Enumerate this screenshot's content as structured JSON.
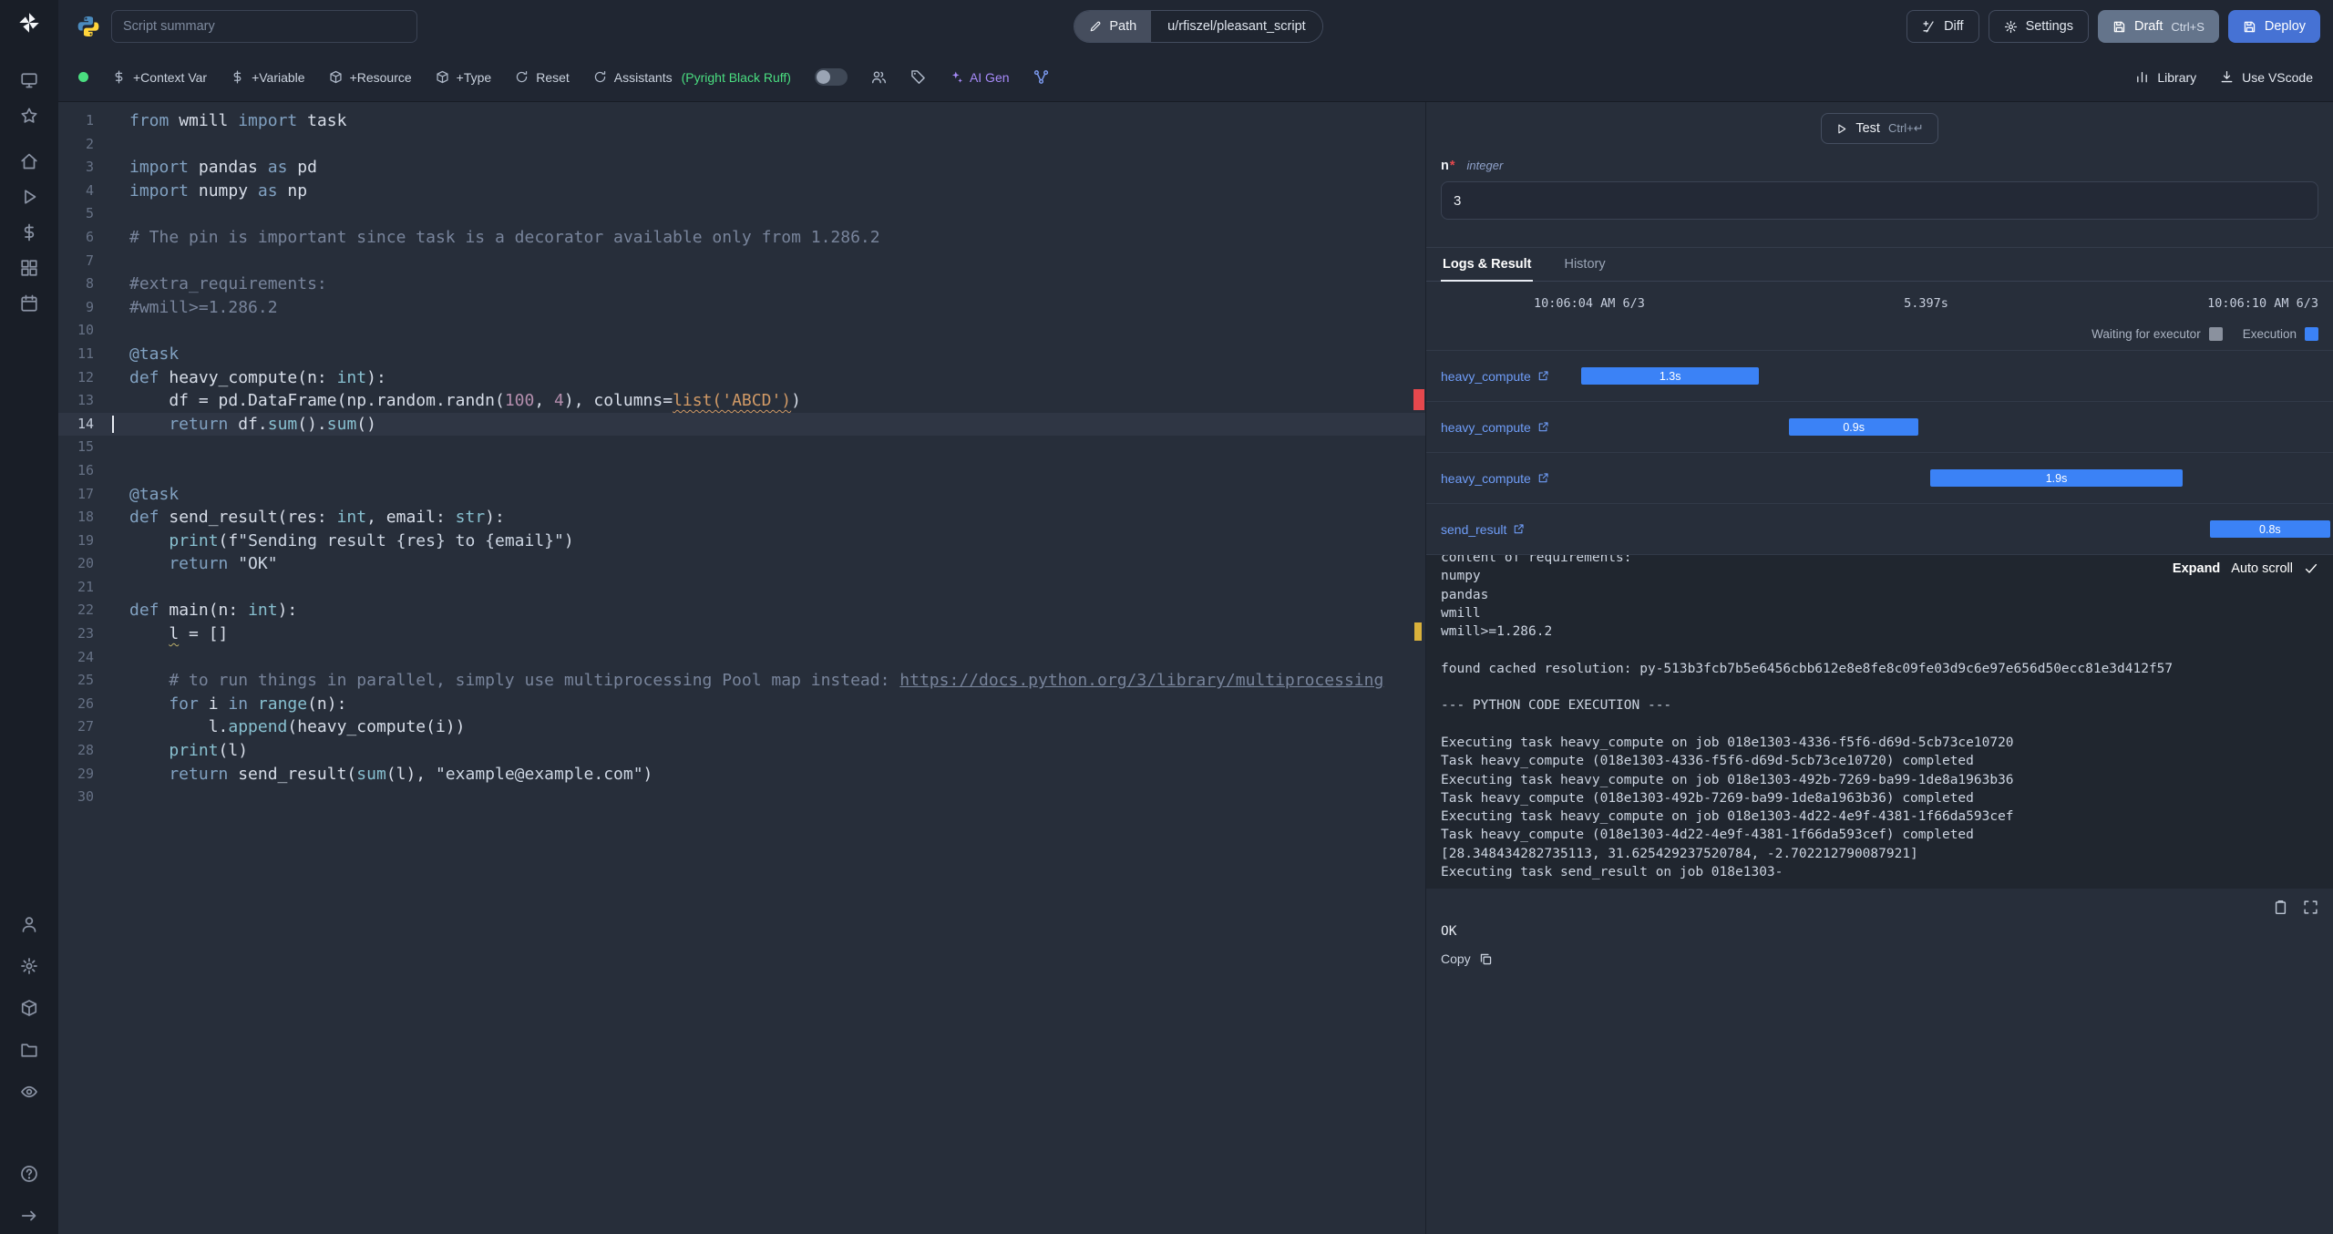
{
  "header": {
    "summary_placeholder": "Script summary",
    "path_label": "Path",
    "path_value": "u/rfiszel/pleasant_script",
    "diff_label": "Diff",
    "settings_label": "Settings",
    "draft_label": "Draft",
    "draft_shortcut": "Ctrl+S",
    "deploy_label": "Deploy"
  },
  "toolbar": {
    "status_color": "#4ade80",
    "actions": [
      {
        "name": "add-context-var-button",
        "icon": "context-var-icon",
        "label": "+Context Var"
      },
      {
        "name": "add-variable-button",
        "icon": "variable-icon",
        "label": "+Variable"
      },
      {
        "name": "add-resource-button",
        "icon": "resource-icon",
        "label": "+Resource"
      },
      {
        "name": "add-type-button",
        "icon": "type-icon",
        "label": "+Type"
      },
      {
        "name": "reset-button",
        "icon": "reset-icon",
        "label": "Reset"
      },
      {
        "name": "assistants-button",
        "icon": "assistants-icon",
        "label": "Assistants",
        "extra": "(Pyright Black Ruff)"
      }
    ],
    "ai_gen_label": "AI Gen",
    "library_label": "Library",
    "vscode_label": "Use VScode"
  },
  "sidebar": {
    "top_groups": [
      [
        "apps-icon",
        "favorites-icon"
      ],
      [
        "home-icon",
        "runs-icon",
        "variables-icon",
        "resources-icon",
        "schedules-icon"
      ]
    ],
    "bottom_icons": [
      "account-icon",
      "workspace-settings-icon",
      "workers-icon",
      "folders-icon",
      "audit-logs-icon",
      "help-icon",
      "collapse-icon"
    ]
  },
  "editor": {
    "active_line": 14,
    "lines": [
      [
        [
          "k",
          "from"
        ],
        [
          "n",
          " wmill "
        ],
        [
          "k",
          "import"
        ],
        [
          "n",
          " task"
        ]
      ],
      [],
      [
        [
          "k",
          "import"
        ],
        [
          "n",
          " pandas "
        ],
        [
          "k",
          "as"
        ],
        [
          "n",
          " pd"
        ]
      ],
      [
        [
          "k",
          "import"
        ],
        [
          "n",
          " numpy "
        ],
        [
          "k",
          "as"
        ],
        [
          "n",
          " np"
        ]
      ],
      [],
      [
        [
          "c",
          "# The pin is important since task is a decorator available only from 1.286.2"
        ]
      ],
      [],
      [
        [
          "c",
          "#extra_requirements:"
        ]
      ],
      [
        [
          "c",
          "#wmill>=1.286.2"
        ]
      ],
      [],
      [
        [
          "d",
          "@task"
        ]
      ],
      [
        [
          "k",
          "def"
        ],
        [
          "n",
          " heavy_compute(n: "
        ],
        [
          "t",
          "int"
        ],
        [
          "n",
          "):"
        ]
      ],
      [
        [
          "n",
          "    df = pd.DataFrame(np.random.randn("
        ],
        [
          "num",
          "100"
        ],
        [
          "n",
          ", "
        ],
        [
          "num",
          "4"
        ],
        [
          "n",
          "), columns="
        ],
        [
          "wr",
          "list('ABCD')"
        ],
        [
          "n",
          ")"
        ]
      ],
      [
        [
          "k",
          "    return"
        ],
        [
          "n",
          " df."
        ],
        [
          "b",
          "sum"
        ],
        [
          "n",
          "()."
        ],
        [
          "b",
          "sum"
        ],
        [
          "n",
          "()"
        ]
      ],
      [],
      [],
      [
        [
          "d",
          "@task"
        ]
      ],
      [
        [
          "k",
          "def"
        ],
        [
          "n",
          " send_result(res: "
        ],
        [
          "t",
          "int"
        ],
        [
          "n",
          ", email: "
        ],
        [
          "t",
          "str"
        ],
        [
          "n",
          "):"
        ]
      ],
      [
        [
          "n",
          "    "
        ],
        [
          "b",
          "print"
        ],
        [
          "n",
          "(f"
        ],
        [
          "s",
          "\"Sending result {res} to {email}\""
        ],
        [
          "n",
          ")"
        ]
      ],
      [
        [
          "k",
          "    return"
        ],
        [
          "n",
          " "
        ],
        [
          "s",
          "\"OK\""
        ]
      ],
      [],
      [
        [
          "k",
          "def"
        ],
        [
          "n",
          " main(n: "
        ],
        [
          "t",
          "int"
        ],
        [
          "n",
          "):"
        ]
      ],
      [
        [
          "n",
          "    "
        ],
        [
          "wv",
          "l"
        ],
        [
          "n",
          " = []"
        ]
      ],
      [],
      [
        [
          "c",
          "    # to run things in parallel, simply use multiprocessing Pool map instead: "
        ],
        [
          "lk",
          "https://docs.python.org/3/library/multiprocessing"
        ]
      ],
      [
        [
          "k",
          "    for"
        ],
        [
          "n",
          " i "
        ],
        [
          "k",
          "in"
        ],
        [
          "n",
          " "
        ],
        [
          "b",
          "range"
        ],
        [
          "n",
          "(n):"
        ]
      ],
      [
        [
          "n",
          "        l."
        ],
        [
          "b",
          "append"
        ],
        [
          "n",
          "(heavy_compute(i))"
        ]
      ],
      [
        [
          "n",
          "    "
        ],
        [
          "b",
          "print"
        ],
        [
          "n",
          "(l)"
        ]
      ],
      [
        [
          "k",
          "    return"
        ],
        [
          "n",
          " send_result("
        ],
        [
          "b",
          "sum"
        ],
        [
          "n",
          "(l), "
        ],
        [
          "s",
          "\"example@example.com\""
        ],
        [
          "n",
          ")"
        ]
      ],
      []
    ]
  },
  "run_panel": {
    "test_label": "Test",
    "test_shortcut": "Ctrl+↵",
    "arg": {
      "name": "n",
      "required_mark": "*",
      "type": "integer",
      "value": "3"
    },
    "tabs": [
      "Logs & Result",
      "History"
    ],
    "start_time": "10:06:04 AM 6/3",
    "duration": "5.397s",
    "end_time": "10:06:10 AM 6/3",
    "legend": [
      {
        "label": "Waiting for executor",
        "color": "#8a919e"
      },
      {
        "label": "Execution",
        "color": "#3b82f6"
      }
    ],
    "gantt": [
      {
        "task": "heavy_compute",
        "duration": "1.3s",
        "start": 17.1,
        "width": 19.6
      },
      {
        "task": "heavy_compute",
        "duration": "0.9s",
        "start": 40.0,
        "width": 14.3
      },
      {
        "task": "heavy_compute",
        "duration": "1.9s",
        "start": 55.6,
        "width": 27.8
      },
      {
        "task": "send_result",
        "duration": "0.8s",
        "start": 86.4,
        "width": 13.3
      }
    ],
    "logs": {
      "expand_label": "Expand",
      "autoscroll_label": "Auto scroll",
      "lines": [
        "content of requirements:",
        "numpy",
        "pandas",
        "wmill",
        "wmill>=1.286.2",
        "",
        "found cached resolution: py-513b3fcb7b5e6456cbb612e8e8fe8c09fe03d9c6e97e656d50ecc81e3d412f57",
        "",
        "--- PYTHON CODE EXECUTION ---",
        "",
        "Executing task heavy_compute on job 018e1303-4336-f5f6-d69d-5cb73ce10720",
        "Task heavy_compute (018e1303-4336-f5f6-d69d-5cb73ce10720) completed",
        "Executing task heavy_compute on job 018e1303-492b-7269-ba99-1de8a1963b36",
        "Task heavy_compute (018e1303-492b-7269-ba99-1de8a1963b36) completed",
        "Executing task heavy_compute on job 018e1303-4d22-4e9f-4381-1f66da593cef",
        "Task heavy_compute (018e1303-4d22-4e9f-4381-1f66da593cef) completed",
        "[28.348434282735113, 31.625429237520784, -2.702212790087921]",
        "Executing task send_result on job 018e1303-"
      ]
    },
    "result": "OK",
    "copy_label": "Copy"
  }
}
